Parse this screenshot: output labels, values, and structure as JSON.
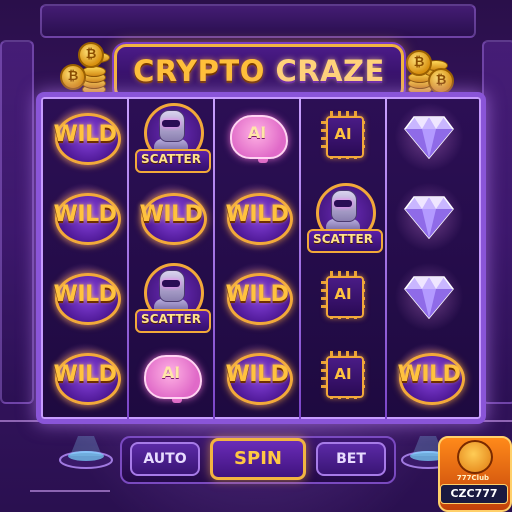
{
  "game": {
    "title_part1": "CRYPTO",
    "title_part2": "CRAZE"
  },
  "symbols": {
    "wild": "WILD",
    "scatter": "SCATTER",
    "ai": "AI"
  },
  "reels": [
    [
      "wild",
      "wild",
      "wild",
      "wild"
    ],
    [
      "robot",
      "wild",
      "robot",
      "brain"
    ],
    [
      "brain",
      "wild",
      "wild",
      "wild"
    ],
    [
      "chip",
      "robot",
      "chip",
      "chip"
    ],
    [
      "diamond",
      "diamond",
      "diamond",
      "wild"
    ]
  ],
  "coin_symbol": "₿",
  "controls": {
    "auto": "AUTO",
    "spin": "SPIN",
    "bet": "BET"
  },
  "brand": {
    "small_text": "777Club",
    "main_text": "CZC777"
  },
  "colors": {
    "accent_gold": "#f2b441",
    "frame_purple": "#8a55d8",
    "background": "#2a0f4a"
  }
}
